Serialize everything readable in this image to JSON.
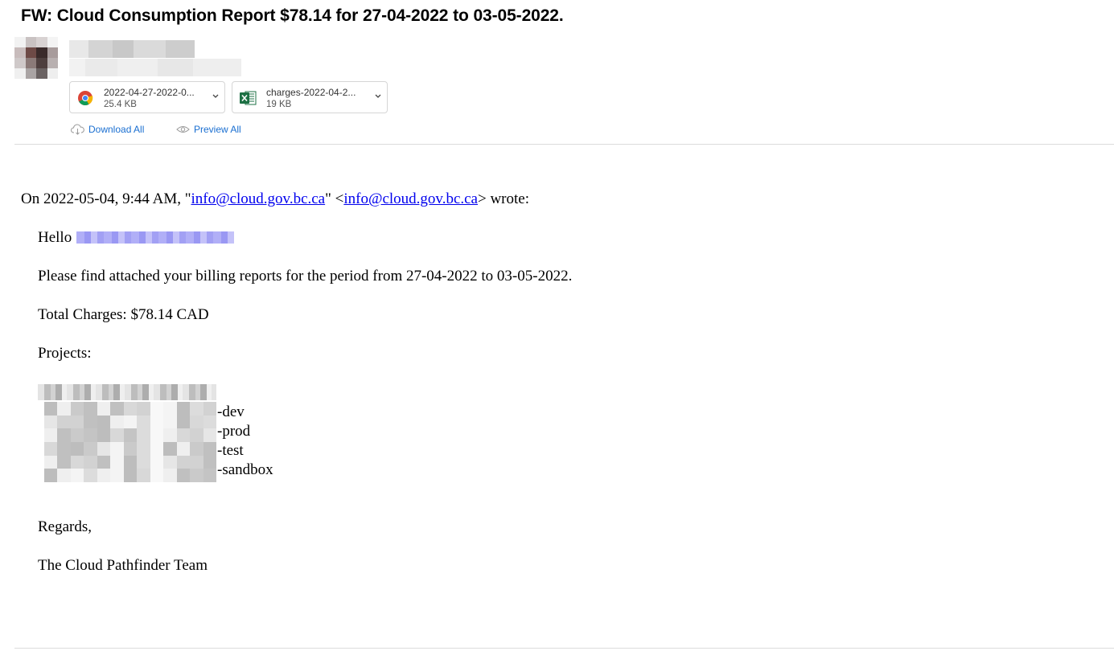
{
  "email": {
    "subject": "FW: Cloud Consumption Report $78.14 for 27-04-2022 to 03-05-2022."
  },
  "attachments": [
    {
      "name": "2022-04-27-2022-0...",
      "size": "25.4 KB",
      "icon": "chrome-pdf-icon"
    },
    {
      "name": "charges-2022-04-2...",
      "size": "19 KB",
      "icon": "excel-icon"
    }
  ],
  "actions": {
    "download_all": "Download All",
    "preview_all": "Preview All"
  },
  "quote": {
    "prefix": "On 2022-05-04, 9:44 AM, \"",
    "email1": "info@cloud.gov.bc.ca",
    "middle": "\" <",
    "email2": "info@cloud.gov.bc.ca",
    "suffix": "> wrote:"
  },
  "body": {
    "greeting": "Hello",
    "period": "Please find attached your billing reports for the period from 27-04-2022 to 03-05-2022.",
    "total": "Total Charges: $78.14 CAD",
    "projects_label": "Projects:",
    "project_suffixes": [
      "-dev",
      "-prod",
      "-test",
      "-sandbox"
    ],
    "regards": "Regards,",
    "team": "The Cloud Pathfinder Team"
  },
  "colors": {
    "link": "#0000ee",
    "action": "#1a6fd1",
    "excel_green": "#1d7044"
  }
}
